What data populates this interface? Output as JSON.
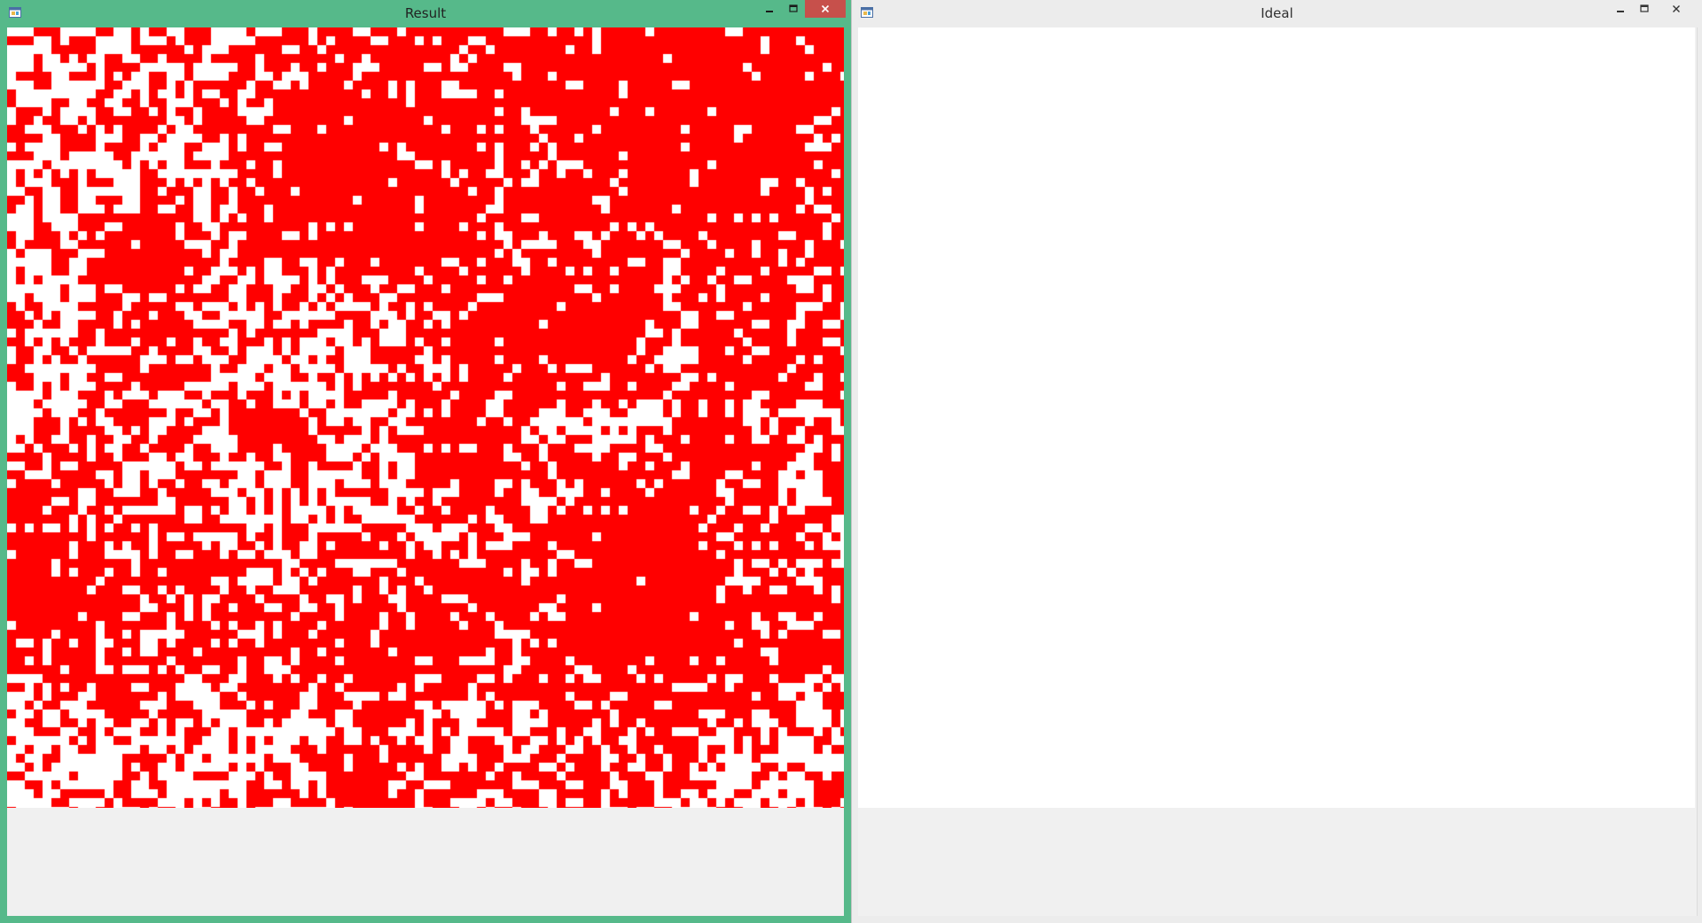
{
  "windows": {
    "result": {
      "title": "Result",
      "state": "active",
      "frame_color": "#56b98a",
      "close_color": "#c7504b"
    },
    "ideal": {
      "title": "Ideal",
      "state": "inactive",
      "frame_color": "#ececec"
    }
  },
  "caption_buttons": [
    "minimize-icon",
    "maximize-icon",
    "close-icon"
  ],
  "colors": {
    "cell_fill": "#ff0000",
    "background": "#ffffff",
    "client_bg": "#f0f0f0"
  }
}
